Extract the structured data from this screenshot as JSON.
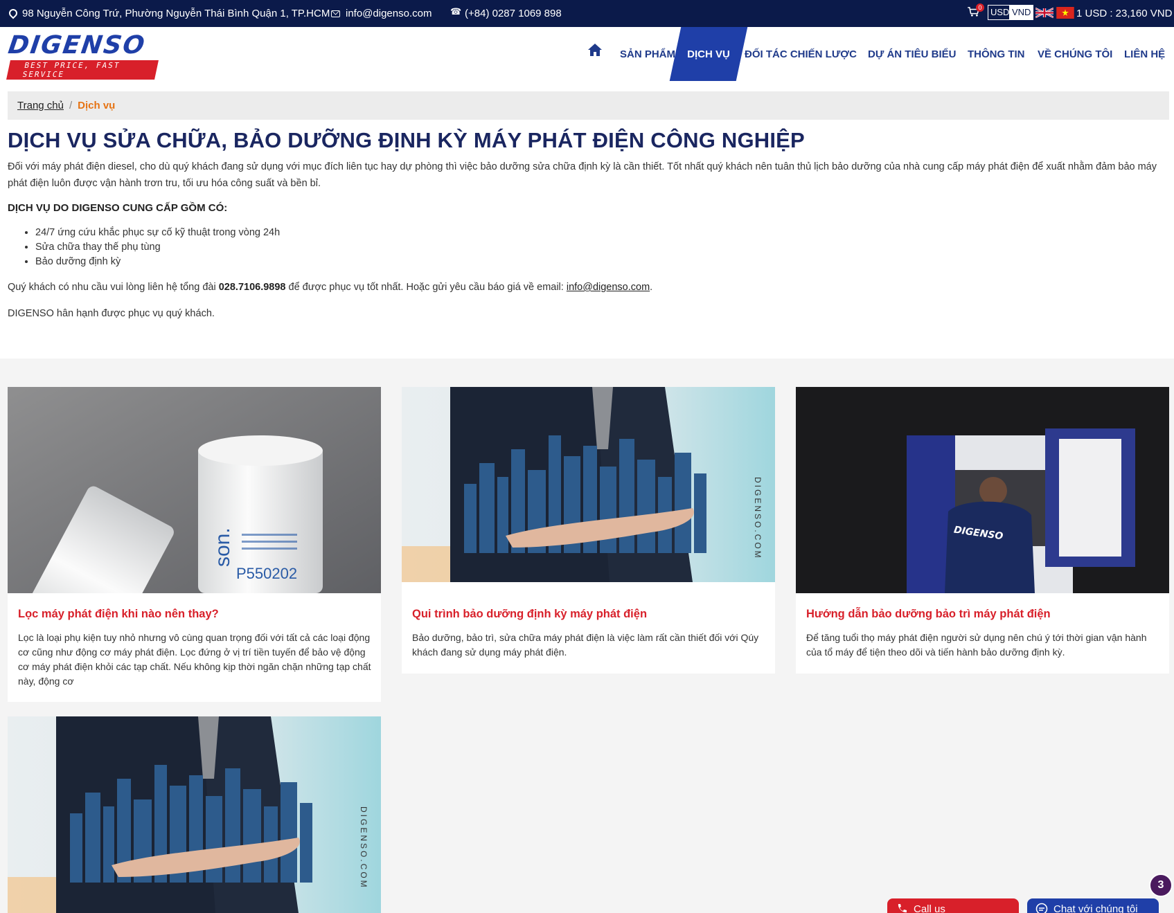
{
  "topbar": {
    "address": "98 Nguyễn Công Trứ, Phường Nguyễn Thái Bình Quận 1, TP.HCM",
    "email": "info@digenso.com",
    "phone": "(+84) 0287 1069 898",
    "cart_count": "0",
    "currency_usd": "USD",
    "currency_vnd": "VND",
    "rate": "1 USD : 23,160 VND"
  },
  "logo": {
    "text": "DIGENSO",
    "tagline": "BEST PRICE, FAST SERVICE"
  },
  "nav": {
    "items": [
      "SẢN PHẨM",
      "DỊCH VỤ",
      "ĐỐI TÁC CHIẾN LƯỢC",
      "DỰ ÁN TIÊU BIỂU",
      "THÔNG TIN",
      "VỀ CHÚNG TÔI",
      "LIÊN HỆ"
    ],
    "active": "DỊCH VỤ"
  },
  "breadcrumb": {
    "home": "Trang chủ",
    "separator": "/",
    "current": "Dịch vụ"
  },
  "content": {
    "title": "DỊCH VỤ SỬA CHỮA, BẢO DƯỠNG ĐỊNH KỲ MÁY PHÁT ĐIỆN CÔNG NGHIỆP",
    "intro": "Đối với máy phát điện diesel, cho dù quý khách đang sử dụng với mục đích liên tục hay dự phòng thì việc bảo dưỡng sửa chữa định kỳ là cần thiết. Tốt nhất quý khách nên tuân thủ lịch bảo dưỡng của nhà cung cấp máy phát điện để xuất nhằm đảm bảo máy phát điện luôn được vận hành trơn tru, tối ưu hóa công suất và bền bỉ.",
    "subheading": "DỊCH VỤ DO DIGENSO CUNG CẤP GỒM CÓ:",
    "services": [
      "24/7 ứng cứu khắc phục sự cố kỹ thuật trong vòng 24h",
      "Sửa chữa thay thế phụ tùng",
      "Bảo dưỡng định kỳ"
    ],
    "contact_before": "Quý khách có nhu cầu vui lòng liên hệ tổng đài ",
    "contact_phone": "028.7106.9898",
    "contact_middle": " để được phục vụ tốt nhất. Hoặc gửi yêu cầu báo giá về email: ",
    "contact_email": "info@digenso.com",
    "contact_end": ".",
    "thanks": "DIGENSO hân hạnh được phục vụ quý khách."
  },
  "cards": [
    {
      "title": "Lọc máy phát điện khi nào nên thay?",
      "excerpt": "Lọc là loại phụ kiện tuy nhỏ nhưng vô cùng quan trọng đối với tất cả các loại động cơ cũng như động cơ máy phát điện. Lọc đứng ở vị trí tiền tuyến để bảo vệ động cơ máy phát điện khỏi các tạp chất. Nếu không kịp thời ngăn chặn những tạp chất này, động cơ",
      "image_label": "P550202",
      "image_brand": "son."
    },
    {
      "title": "Qui trình bảo dưỡng định kỳ máy phát điện",
      "excerpt": "Bảo dưỡng, bảo trì, sửa chữa máy phát điện là việc làm rất cần thiết đối với Qúy khách đang sử dụng máy phát điện.",
      "image_label": "DIGENSO.COM"
    },
    {
      "title": "Hướng dẫn bảo dưỡng bảo trì máy phát điện",
      "excerpt": "Để tăng tuổi thọ máy phát điện người sử dụng nên chú ý tới thời gian vận hành của tổ máy để tiện theo dõi và tiến hành bảo dưỡng định kỳ.",
      "image_label": "DIGENSO"
    },
    {
      "image_label": "DIGENSO.COM"
    }
  ],
  "floating": {
    "call_label": "Call us",
    "chat_label": "Chat với chúng tôi",
    "notification_count": "3"
  }
}
